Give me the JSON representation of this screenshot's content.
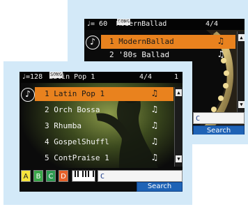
{
  "back_screen": {
    "header": {
      "tempo": "♩= 60",
      "mode_icon": "SONG",
      "style_name": "ModernBallad",
      "time_sig": "4/4"
    },
    "list": [
      {
        "label": "1 ModernBallad",
        "selected": true
      },
      {
        "label": "2 '80s Ballad",
        "selected": false
      }
    ],
    "search_field": "C",
    "search_button": "Search"
  },
  "front_screen": {
    "header": {
      "tempo": "♩=128",
      "mode_icon": "SONG",
      "style_name": "Latin Pop 1",
      "time_sig": "4/4",
      "tail": "1"
    },
    "list": [
      {
        "label": "1 Latin Pop 1",
        "selected": true
      },
      {
        "label": "2 Orch Bossa",
        "selected": false
      },
      {
        "label": "3 Rhumba",
        "selected": false
      },
      {
        "label": "4 GospelShuffl",
        "selected": false
      },
      {
        "label": "5 ContPraise 1",
        "selected": false
      }
    ],
    "category_buttons": [
      {
        "label": "A",
        "color": "#f6e43c"
      },
      {
        "label": "B",
        "color": "#3aa64a"
      },
      {
        "label": "C",
        "color": "#2f9a52"
      },
      {
        "label": "D",
        "color": "#e6612a"
      }
    ],
    "search_field": "C",
    "search_button": "Search"
  },
  "icons": {
    "note": "♪",
    "style": "♫",
    "scroll_up": "▲",
    "scroll_down": "▼"
  }
}
